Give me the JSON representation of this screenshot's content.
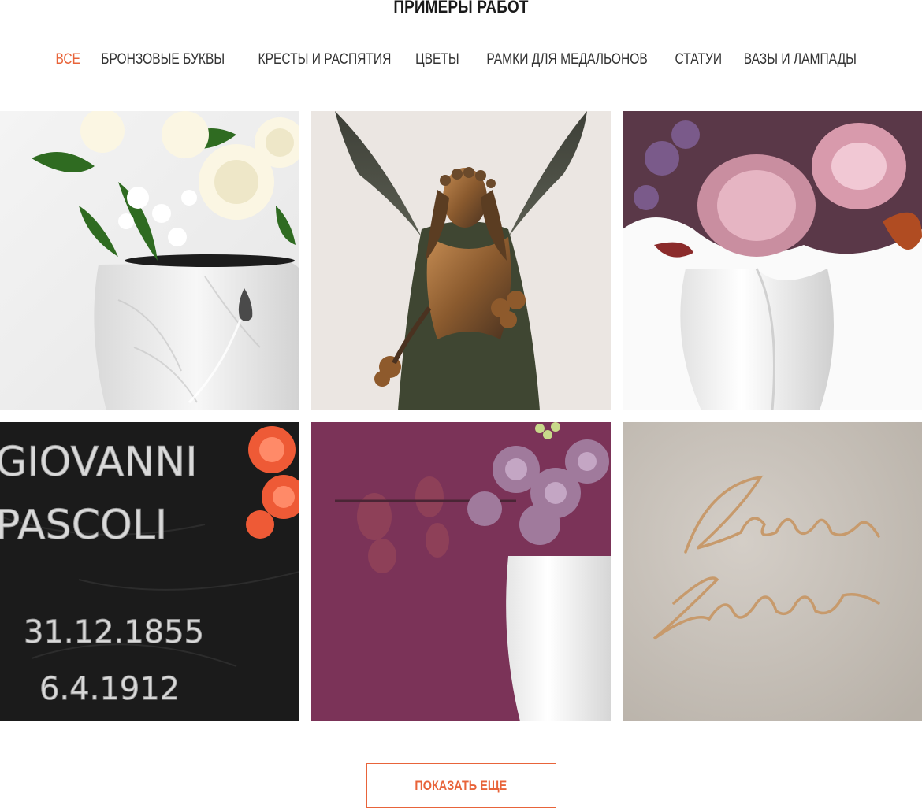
{
  "section": {
    "title": "ПРИМЕРЫ РАБОТ"
  },
  "filters": [
    {
      "label": "ВСЕ",
      "active": true
    },
    {
      "label": "БРОНЗОВЫЕ БУКВЫ",
      "active": false
    },
    {
      "label": "КРЕСТЫ И РАСПЯТИЯ",
      "active": false
    },
    {
      "label": "ЦВЕТЫ",
      "active": false
    },
    {
      "label": "РАМКИ ДЛЯ МЕДАЛЬОНОВ",
      "active": false
    },
    {
      "label": "СТАТУИ",
      "active": false
    },
    {
      "label": "ВАЗЫ И ЛАМПАДЫ",
      "active": false
    }
  ],
  "gallery": {
    "tiles": [
      {
        "subject": "white-marble-vase-with-peonies"
      },
      {
        "subject": "bronze-angel-statue"
      },
      {
        "subject": "white-vase-with-anthurium"
      },
      {
        "subject": "marble-plaque-with-letters",
        "plaque": {
          "name1": "GIOVANNI",
          "name2": "PASCOLI",
          "date1": "31.12.1855",
          "date2": "6.4.1912"
        }
      },
      {
        "subject": "white-vase-purple-background"
      },
      {
        "subject": "bronze-signature-lettering"
      }
    ]
  },
  "actions": {
    "show_more": "ПОКАЗАТЬ ЕЩЕ"
  },
  "colors": {
    "accent": "#e8643a",
    "text": "#333333"
  }
}
